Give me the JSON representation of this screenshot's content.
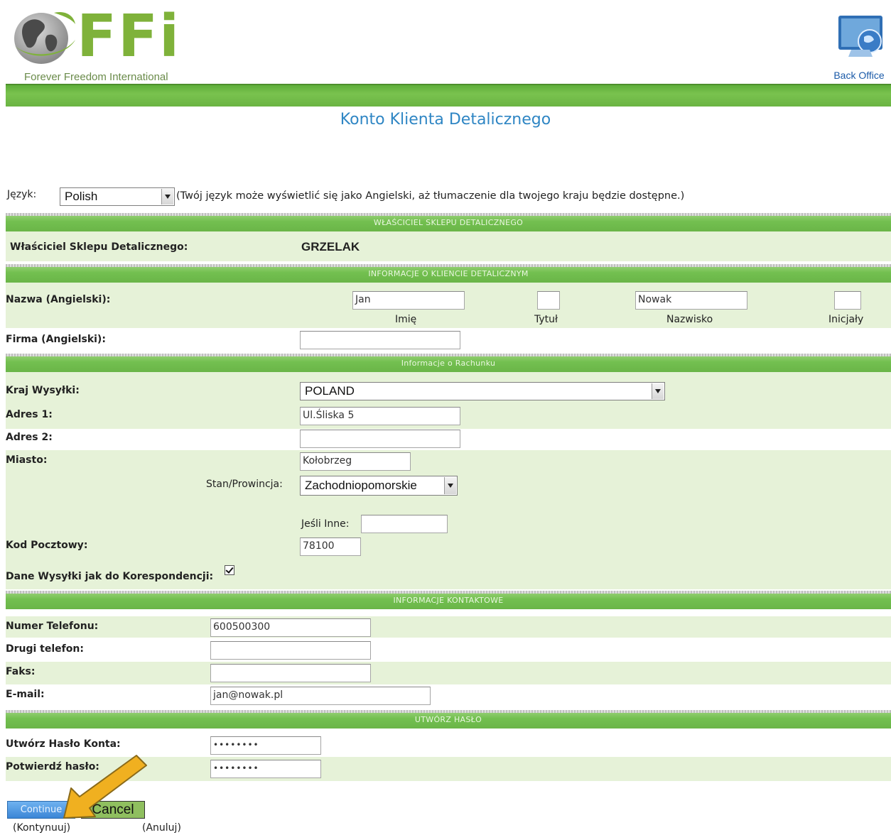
{
  "header": {
    "logo_letters": "FFi",
    "logo_tagline": "Forever Freedom International",
    "back_office_label": "Back Office"
  },
  "page_title": "Konto Klienta Detalicznego",
  "language": {
    "label": "Język:",
    "selected": "Polish",
    "note": "(Twój język może wyświetlić się jako Angielski, aż tłumaczenie dla twojego kraju będzie dostępne.)"
  },
  "sections": {
    "owner": "WŁAŚCICIEL SKLEPU DETALICZNEGO",
    "customer_info": "INFORMACJE O KLIENCIE DETALICZNYM",
    "account_info": "Informacje o Rachunku",
    "contact_info": "INFORMACJE KONTAKTOWE",
    "password": "UTWÓRZ HASŁO"
  },
  "owner": {
    "label": "Właściciel Sklepu Detalicznego:",
    "value": "GRZELAK"
  },
  "customer": {
    "name_label": "Nazwa (Angielski):",
    "first_name": "Jan",
    "first_name_caption": "Imię",
    "title": "",
    "title_caption": "Tytuł",
    "last_name": "Nowak",
    "last_name_caption": "Nazwisko",
    "initials": "",
    "initials_caption": "Inicjały",
    "company_label": "Firma (Angielski):",
    "company": ""
  },
  "account": {
    "country_label": "Kraj Wysyłki:",
    "country": "POLAND",
    "address1_label": "Adres 1:",
    "address1": "Ul.Śliska 5",
    "address2_label": "Adres 2:",
    "address2": "",
    "city_label": "Miasto:",
    "city": "Kołobrzeg",
    "state_label": "Stan/Prowincja:",
    "state": "Zachodniopomorskie",
    "other_label": "Jeśli Inne:",
    "other": "",
    "postal_label": "Kod Pocztowy:",
    "postal": "78100",
    "same_shipping_label": "Dane Wysyłki jak do Korespondencji:",
    "same_shipping_checked": true
  },
  "contact": {
    "phone_label": "Numer Telefonu:",
    "phone": "600500300",
    "phone2_label": "Drugi telefon:",
    "phone2": "",
    "fax_label": "Faks:",
    "fax": "",
    "email_label": "E-mail:",
    "email": "jan@nowak.pl"
  },
  "password": {
    "create_label": "Utwórz Hasło Konta:",
    "create_value": "••••••••",
    "confirm_label": "Potwierdź hasło:",
    "confirm_value": "••••••••"
  },
  "buttons": {
    "continue": "Continue",
    "continue_caption": "(Kontynuuj)",
    "cancel": "Cancel",
    "cancel_caption": "(Anuluj)"
  },
  "colors": {
    "header_green": "#6bb443",
    "title_blue": "#2f86c4",
    "band_green": "#e6f2d8",
    "arrow_orange": "#f0b020"
  }
}
